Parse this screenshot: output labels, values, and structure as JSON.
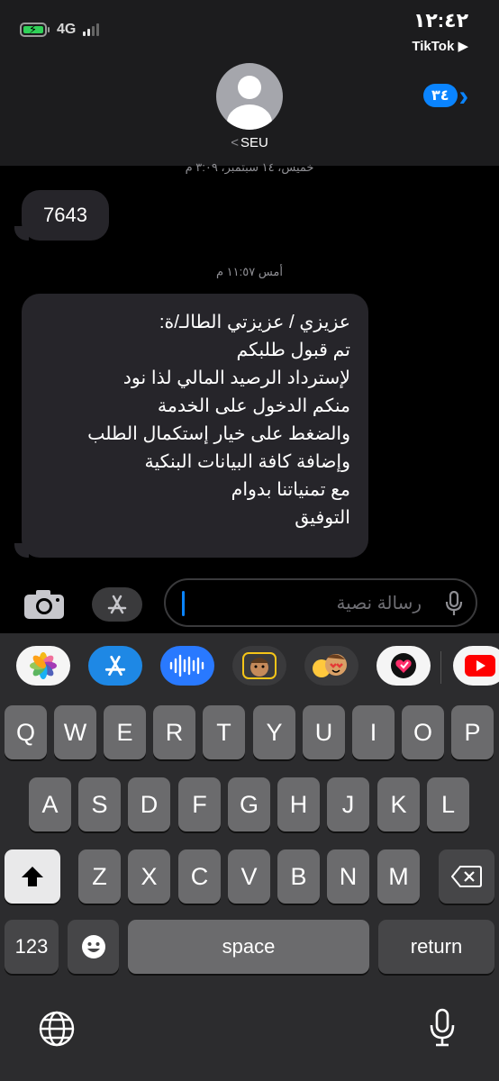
{
  "status_bar": {
    "network": "4G",
    "time": "١٢:٤٢",
    "back_app": "TikTok ▶"
  },
  "header": {
    "contact_name": "SEU",
    "unread_count": "٣٤"
  },
  "messages": [
    {
      "timestamp": "خميس، ١٤ سبتمبر، ٣:٠٩ م",
      "text": "7643"
    },
    {
      "timestamp": "أمس ١١:٥٧ م",
      "text": "عزيزي / عزيزتي الطالـ/ة:\nتم قبول طلبكم\nلإسترداد الرصيد المالي لذا نود\nمنكم الدخول على الخدمة\nوالضغط على خيار إستكمال الطلب\nوإضافة كافة البيانات البنكية\nمع تمنياتنا بدوام\nالتوفيق"
    }
  ],
  "compose": {
    "placeholder": "رسالة نصية"
  },
  "app_drawer": [
    "photos-icon",
    "app-store-icon",
    "audio-message-icon",
    "memoji-icon",
    "animoji-stickers-icon",
    "digital-touch-icon",
    "youtube-icon"
  ],
  "keyboard": {
    "row1": [
      "Q",
      "W",
      "E",
      "R",
      "T",
      "Y",
      "U",
      "I",
      "O",
      "P"
    ],
    "row2": [
      "A",
      "S",
      "D",
      "F",
      "G",
      "H",
      "J",
      "K",
      "L"
    ],
    "row3": [
      "Z",
      "X",
      "C",
      "V",
      "B",
      "N",
      "M"
    ],
    "numbers_label": "123",
    "space_label": "space",
    "return_label": "return"
  },
  "colors": {
    "accent": "#0a84ff",
    "bubble": "#26252a",
    "keyboard_bg": "#2c2c2e"
  }
}
